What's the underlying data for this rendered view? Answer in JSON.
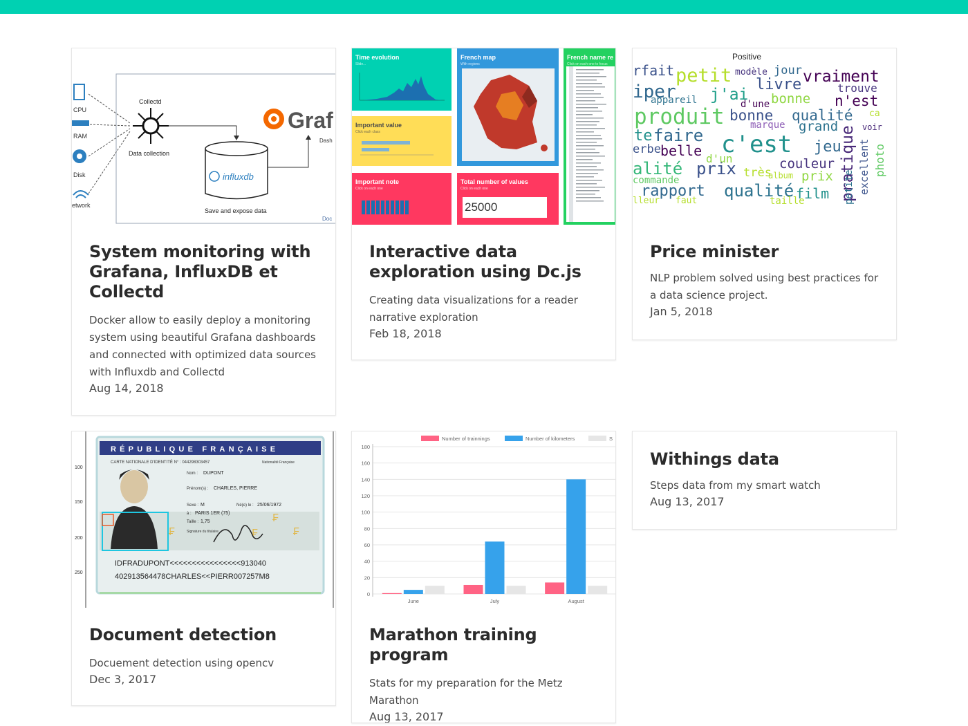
{
  "cards": [
    {
      "title": "System monitoring with Grafana, InfluxDB et Collectd",
      "desc": "Docker allow to easily deploy a monitoring system using beautiful Grafana dashboards and connected with optimized data sources with Influxdb and Collectd",
      "date": "Aug 14, 2018",
      "thumb": {
        "collectd": "Collectd",
        "data_collection": "Data collection",
        "grafana": "Graf",
        "dash": "Dash",
        "influxdb": "influxdb",
        "save": "Save and expose data",
        "doc": "Doc",
        "cpu": "CPU",
        "ram": "RAM",
        "disk": "Disk",
        "network": "etwork"
      }
    },
    {
      "title": "Interactive data exploration using Dc.js",
      "desc": "Creating data visualizations for a reader narrative exploration",
      "date": "Feb 18, 2018",
      "thumb": {
        "time_evolution": "Time evolution",
        "time_sub": "Slide...",
        "french_map": "French map",
        "map_sub": "With regions",
        "french_name": "French name re",
        "name_sub": "Click on each one to focus",
        "important_value": "Important value",
        "value_sub": "Click each class",
        "important_note": "Important note",
        "note_sub": "Click on each one",
        "total": "Total number of values",
        "total_sub": "Click on each one",
        "total_value": "25000"
      }
    },
    {
      "title": "Price minister",
      "desc": "NLP problem solved using best practices for a data science project.",
      "date": "Jan 5, 2018",
      "thumb": {
        "heading": "Positive",
        "words": [
          "rfait",
          "petit",
          "modèle",
          "jour",
          "vraiment",
          "iper",
          "j'ai",
          "livre",
          "trouve",
          "appareil",
          "bonne",
          "n'est",
          "produit",
          "bonne",
          "qualité",
          "ca",
          "te",
          "faire",
          "marque",
          "grand",
          "voir",
          "erbe",
          "belle",
          "c'est",
          "jeu",
          "alité",
          "prix",
          "couleur",
          "commande",
          "rapport",
          "qualité",
          "film",
          "pratique",
          "excellent",
          "photo",
          "lleur",
          "faut",
          "taille",
          "petite",
          "d'un",
          "d'une",
          "très",
          "album",
          "prix"
        ]
      }
    },
    {
      "title": "Document detection",
      "desc": "Docuement detection using opencv",
      "date": "Dec 3, 2017",
      "thumb": {
        "header": "RÉPUBLIQUE FRANÇAISE",
        "card_label": "CARTE NATIONALE D'IDENTITÉ N° : 044298303457",
        "nationality": "Nationalité Française",
        "nom_label": "Nom :",
        "nom": "DUPONT",
        "prenom_label": "Prénom(s) :",
        "prenom": "CHARLES, PIERRE",
        "sexe_label": "Sexe :",
        "sexe": "M",
        "ne_label": "Né(e) le :",
        "ne": "25/06/1972",
        "a_label": "à :",
        "a": "PARIS 1ER (75)",
        "taille_label": "Taille :",
        "taille": "1,75",
        "sig_label": "Signature du titulaire",
        "mrz1": "IDFRADUPONT<<<<<<<<<<<<<<<<913040",
        "mrz2": "402913564478CHARLES<<PIERR007257M8",
        "axis": [
          "100",
          "150",
          "200",
          "250"
        ]
      }
    },
    {
      "title": "Marathon training program",
      "desc": "Stats for my preparation for the Metz Marathon",
      "date": "Aug 13, 2017",
      "chart_data": {
        "type": "bar",
        "categories": [
          "June",
          "July",
          "August"
        ],
        "series": [
          {
            "name": "Number of trainnings",
            "values": [
              1,
              11,
              14
            ],
            "color": "#ff6384"
          },
          {
            "name": "Number of kilometers",
            "values": [
              5,
              64,
              140
            ],
            "color": "#36a2eb"
          },
          {
            "name": "S",
            "values": [
              10,
              10,
              10
            ],
            "color": "#e6e6e6"
          }
        ],
        "yticks": [
          "0",
          "20",
          "40",
          "60",
          "80",
          "100",
          "120",
          "140",
          "160",
          "180"
        ],
        "ylim": [
          0,
          180
        ],
        "legend": "top",
        "grid": true
      }
    },
    {
      "title": "Withings data",
      "desc": "Steps data from my smart watch",
      "date": "Aug 13, 2017"
    }
  ]
}
